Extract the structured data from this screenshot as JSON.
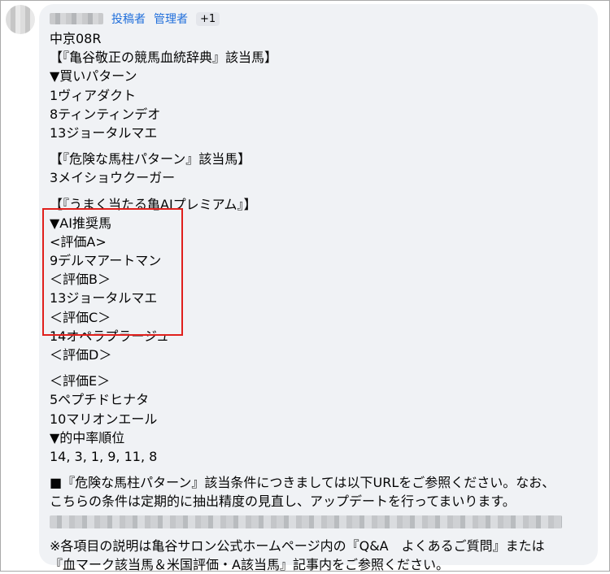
{
  "comment": {
    "roles": [
      "投稿者",
      "管理者"
    ],
    "badge": "+1",
    "lines_block1": [
      "中京08R",
      "【『亀谷敬正の競馬血統辞典』該当馬】",
      "▼買いパターン",
      "1ヴィアダクト",
      "8ティンティンデオ",
      "13ジョータルマエ"
    ],
    "lines_block2": [
      "【『危険な馬柱パターン』該当馬】",
      "3メイショウクーガー"
    ],
    "lines_block3": [
      "【『うまく当たる亀AIプレミアム』】",
      "▼AI推奨馬",
      "<評価A>",
      "9デルマアートマン",
      "＜評価B＞",
      "13ジョータルマエ",
      "＜評価C＞",
      "14オペラプラージュ",
      "＜評価D＞"
    ],
    "lines_block4": [
      "＜評価E＞",
      "5ペプチドヒナタ",
      "10マリオンエール",
      "▼的中率順位",
      "14, 3, 1, 9, 11, 8"
    ],
    "notice": [
      "■『危険な馬柱パターン』該当条件につきましては以下URLをご参照ください。なお、",
      "こちらの条件は定期的に抽出精度の見直し、アップデートを行ってまいります。"
    ],
    "footnote": [
      "※各項目の説明は亀谷サロン公式ホームページ内の『Q&A　よくあるご質問』または",
      "『血マーク該当馬＆米国評価・A該当馬』記事内をご参照ください。"
    ]
  },
  "colors": {
    "bubble_bg": "#f0f2f5",
    "role_link": "#216fdb",
    "highlight_border": "#e0201c",
    "text": "#050505"
  }
}
